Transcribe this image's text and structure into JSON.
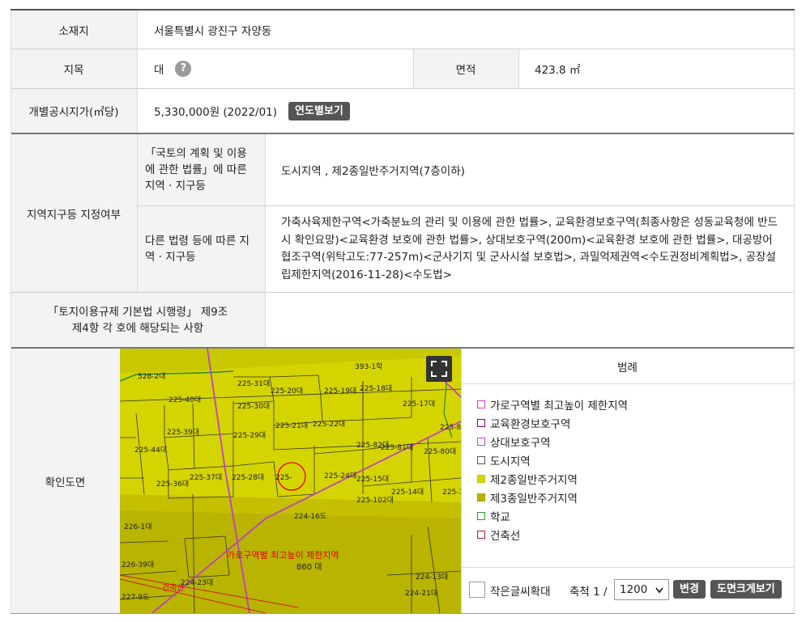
{
  "rows": {
    "location": {
      "label": "소재지",
      "value": "서울특별시 광진구 자양동"
    },
    "land_category": {
      "label": "지목",
      "value": "대",
      "help": "?"
    },
    "area": {
      "label": "면적",
      "value": "423.8 ㎡"
    },
    "official_price": {
      "label": "개별공시지가(㎡당)",
      "value": "5,330,000원 (2022/01)",
      "button": "연도별보기"
    },
    "zoning": {
      "label": "지역지구등 지정여부",
      "sub1_label": "「국토의 계획 및 이용에 관한 법률」에 따른 지역 · 지구등",
      "sub1_value": "도시지역 , 제2종일반주거지역(7층이하)",
      "sub2_label": "다른 법령 등에 따른 지역 · 지구등",
      "sub2_value": "가축사육제한구역<가축분뇨의 관리 및 이용에 관한 법률>, 교육환경보호구역(최종사항은 성동교육청에 반드시 확인요망)<교육환경 보호에 관한 법률>, 상대보호구역(200m)<교육환경 보호에 관한 법률>, 대공방어협조구역(위탁고도:77-257m)<군사기지 및 군사시설 보호법>, 과밀억제권역<수도권정비계획법>, 공장설립제한지역(2016-11-28)<수도법>"
    },
    "regulation": {
      "label": "「토지이용규제 기본법 시행령」 제9조 제4항 각 호에 해당되는 사항",
      "value": ""
    },
    "map_row": {
      "label": "확인도면"
    }
  },
  "map": {
    "parcels": [
      "393-1학",
      "528-2대",
      "225-31대",
      "225-30대",
      "225-40대",
      "225-39대",
      "225-29대",
      "225-21대",
      "225-22대",
      "225-20대",
      "225-19대",
      "225-18대",
      "225-17대",
      "225-86대",
      "225-37대",
      "225-28대",
      "225-",
      "225-24대",
      "225-15대",
      "225-14대",
      "225-102대",
      "225-13대",
      "225-36대",
      "225-44대",
      "226-1대",
      "224-16도",
      "226-39대",
      "224-23대",
      "227-9도",
      "224-13대",
      "224-21대",
      "225-82대",
      "225-81대",
      "225-80대"
    ],
    "zone_label": "가로구역별 최고높이 제한지역",
    "zone_sub": "860 대",
    "building_line": "건축선",
    "colors": {
      "zone2": "#d4d400",
      "zone3": "#b8b400",
      "highlight": "#e00000"
    }
  },
  "legend": {
    "title": "범례",
    "items": [
      {
        "label": "가로구역별 최고높이 제한지역",
        "border": "#cc44cc",
        "fill": "#ffffff"
      },
      {
        "label": "교육환경보호구역",
        "border": "#880088",
        "fill": "#ffffff"
      },
      {
        "label": "상대보호구역",
        "border": "#cc44cc",
        "fill": "#ffffff"
      },
      {
        "label": "도시지역",
        "border": "#555555",
        "fill": "#ffffff"
      },
      {
        "label": "제2종일반주거지역",
        "border": "#c9c900",
        "fill": "#d4d400"
      },
      {
        "label": "제3종일반주거지역",
        "border": "#a8a400",
        "fill": "#b8b400"
      },
      {
        "label": "학교",
        "border": "#2a9a2a",
        "fill": "#ffffff"
      },
      {
        "label": "건축선",
        "border": "#b02020",
        "fill": "#ffffff"
      }
    ]
  },
  "controls": {
    "small_text_label": "작은글씨확대",
    "scale_label": "축척 1 /",
    "scale_value": "1200",
    "change_button": "변경",
    "enlarge_button": "도면크게보기"
  }
}
